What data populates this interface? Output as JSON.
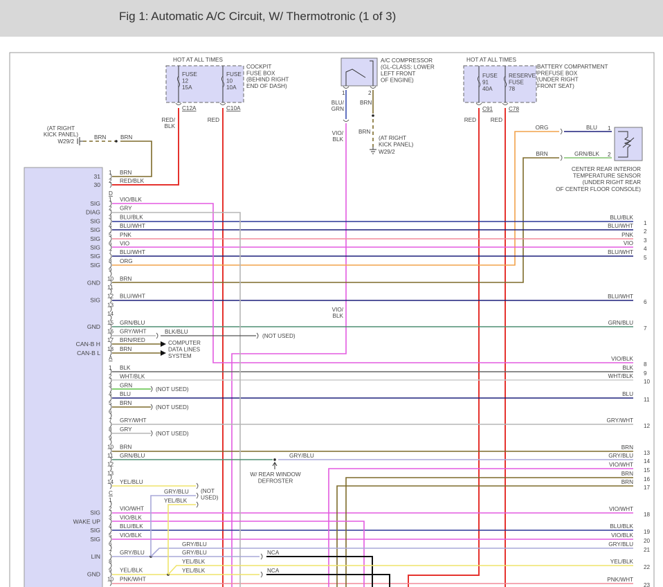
{
  "title": "Fig 1: Automatic A/C Circuit, W/ Thermotronic (1 of 3)",
  "wire_colors": {
    "BRN": "#7d6a2a",
    "RED": "#e5322d",
    "VIO": "#e35ae0",
    "BLU": "#1c1f7a",
    "BLU/BLK": "#2a3596",
    "GRY": "#b5b5b5",
    "PNK": "#f28a9a",
    "ORG": "#f2a24a",
    "GRN/BLU": "#4d8e72",
    "GRN": "#5cc043",
    "GRN/BLK": "#7fc06a",
    "BLK": "#666666",
    "WHT/BLK": "#cccccc",
    "GRY/BLU": "#a8a8d8",
    "YEL": "#efe46a",
    "NCA": "#111111",
    "BLU/GRN": "#3a4fb0",
    "box_fill": "#d9d9f7"
  },
  "main_connector": {
    "pins": [
      {
        "num": "1",
        "wire": "BRN",
        "func": "31"
      },
      {
        "num": "2",
        "wire": "RED/BLK",
        "func": "30"
      }
    ]
  },
  "connector_D": {
    "name": "D",
    "pins": [
      {
        "num": "1",
        "wire": "VIO/BLK",
        "func": "SIG"
      },
      {
        "num": "2",
        "wire": "GRY",
        "func": "DIAG"
      },
      {
        "num": "3",
        "wire": "BLU/BLK",
        "func": "SIG"
      },
      {
        "num": "4",
        "wire": "BLU/WHT",
        "func": "SIG"
      },
      {
        "num": "5",
        "wire": "PNK",
        "func": "SIG"
      },
      {
        "num": "6",
        "wire": "VIO",
        "func": "SIG"
      },
      {
        "num": "7",
        "wire": "BLU/WHT",
        "func": "SIG"
      },
      {
        "num": "8",
        "wire": "ORG",
        "func": "SIG"
      },
      {
        "num": "9",
        "wire": "",
        "func": ""
      },
      {
        "num": "10",
        "wire": "BRN",
        "func": "GND"
      },
      {
        "num": "11",
        "wire": "",
        "func": ""
      },
      {
        "num": "12",
        "wire": "BLU/WHT",
        "func": "SIG"
      },
      {
        "num": "13",
        "wire": "",
        "func": ""
      },
      {
        "num": "14",
        "wire": "",
        "func": ""
      },
      {
        "num": "15",
        "wire": "GRN/BLU",
        "func": "GND"
      },
      {
        "num": "16",
        "wire": "GRY/WHT",
        "func": ""
      },
      {
        "num": "17",
        "wire": "BRN/RED",
        "func": "CAN-B H"
      },
      {
        "num": "18",
        "wire": "BRN",
        "func": "CAN-B L"
      }
    ]
  },
  "connector_A": {
    "name": "A",
    "pins": [
      {
        "num": "1",
        "wire": "BLK"
      },
      {
        "num": "2",
        "wire": "WHT/BLK"
      },
      {
        "num": "3",
        "wire": "GRN"
      },
      {
        "num": "4",
        "wire": "BLU"
      },
      {
        "num": "5",
        "wire": "BRN"
      },
      {
        "num": "6",
        "wire": ""
      },
      {
        "num": "7",
        "wire": "GRY/WHT"
      },
      {
        "num": "8",
        "wire": "GRY"
      },
      {
        "num": "9",
        "wire": ""
      },
      {
        "num": "10",
        "wire": "BRN"
      },
      {
        "num": "11",
        "wire": "GRN/BLU"
      },
      {
        "num": "12",
        "wire": ""
      },
      {
        "num": "13",
        "wire": ""
      },
      {
        "num": "14",
        "wire": "YEL/BLU"
      }
    ]
  },
  "connector_C": {
    "name": "C",
    "pins": [
      {
        "num": "1",
        "wire": "",
        "func": ""
      },
      {
        "num": "2",
        "wire": "VIO/WHT",
        "func": "SIG"
      },
      {
        "num": "3",
        "wire": "VIO/BLK",
        "func": "WAKE UP"
      },
      {
        "num": "4",
        "wire": "BLU/BLK",
        "func": "SIG"
      },
      {
        "num": "5",
        "wire": "VIO/BLK",
        "func": "SIG"
      },
      {
        "num": "6",
        "wire": "",
        "func": ""
      },
      {
        "num": "7",
        "wire": "GRY/BLU",
        "func": "LIN"
      },
      {
        "num": "8",
        "wire": "",
        "func": ""
      },
      {
        "num": "9",
        "wire": "YEL/BLK",
        "func": "GND"
      },
      {
        "num": "10",
        "wire": "PNK/WHT",
        "func": ""
      }
    ]
  },
  "outputs": [
    {
      "num": "1",
      "wire": "BLU/BLK"
    },
    {
      "num": "2",
      "wire": "BLU/WHT"
    },
    {
      "num": "3",
      "wire": "PNK"
    },
    {
      "num": "4",
      "wire": "VIO"
    },
    {
      "num": "5",
      "wire": "BLU/WHT"
    },
    {
      "num": "6",
      "wire": "BLU/WHT"
    },
    {
      "num": "7",
      "wire": "GRN/BLU"
    },
    {
      "num": "8",
      "wire": "VIO/BLK"
    },
    {
      "num": "9",
      "wire": "BLK"
    },
    {
      "num": "10",
      "wire": "WHT/BLK"
    },
    {
      "num": "11",
      "wire": "BLU"
    },
    {
      "num": "12",
      "wire": "GRY/WHT"
    },
    {
      "num": "13",
      "wire": "BRN"
    },
    {
      "num": "14",
      "wire": "GRY/BLU"
    },
    {
      "num": "15",
      "wire": "VIO/WHT"
    },
    {
      "num": "16",
      "wire": "BRN"
    },
    {
      "num": "17",
      "wire": "BRN"
    },
    {
      "num": "18",
      "wire": "VIO/WHT"
    },
    {
      "num": "19",
      "wire": "BLU/BLK"
    },
    {
      "num": "20",
      "wire": "VIO/BLK"
    },
    {
      "num": "21",
      "wire": "GRY/BLU"
    },
    {
      "num": "22",
      "wire": "YEL/BLK"
    },
    {
      "num": "23",
      "wire": "PNK/WHT"
    }
  ],
  "labels": {
    "hot1": "HOT AT ALL TIMES",
    "cockpit": [
      "COCKPIT",
      "FUSE BOX",
      "(BEHIND RIGHT",
      "END OF DASH)"
    ],
    "fuse12": [
      "FUSE",
      "12",
      "15A"
    ],
    "fuse10": [
      "FUSE",
      "10",
      "10A"
    ],
    "c12a": "C12A",
    "c10a": "C10A",
    "red_blk": [
      "RED/",
      "BLK"
    ],
    "red1": "RED",
    "kick1": [
      "(AT RIGHT",
      "KICK PANEL)"
    ],
    "w29_1": "W29/2",
    "brn_a": "BRN",
    "brn_b": "BRN",
    "compressor": [
      "A/C COMPRESSOR",
      "(GL-CLASS: LOWER",
      "LEFT FRONT",
      "OF ENGINE)"
    ],
    "comp_pin1": "1",
    "comp_pin2": "2",
    "blu_grn": [
      "BLU/",
      "GRN"
    ],
    "comp_brn": "BRN",
    "vio_blk_top": [
      "VIO/",
      "BLK"
    ],
    "comp_brn2": "BRN",
    "kick2": [
      "(AT RIGHT",
      "KICK PANEL)"
    ],
    "w29_2": "W29/2",
    "hot2": "HOT AT ALL TIMES",
    "battery": [
      "BATTERY COMPARTMENT",
      "PREFUSE BOX",
      "(UNDER RIGHT",
      "FRONT SEAT)"
    ],
    "fuse91": [
      "FUSE",
      "91",
      "40A"
    ],
    "reserve": [
      "RESERVE",
      "FUSE",
      "78"
    ],
    "c91": "C91",
    "c78": "C78",
    "red2": "RED",
    "red3": "RED",
    "org": "ORG",
    "blu": "BLU",
    "brn_s": "BRN",
    "grn_blk": "GRN/BLK",
    "sensor_pin1": "1",
    "sensor_pin2": "2",
    "sensor": [
      "CENTER REAR INTERIOR",
      "TEMPERATURE SENSOR",
      "(UNDER RIGHT REAR",
      "OF CENTER FLOOR CONSOLE)"
    ],
    "vio_blk_mid": [
      "VIO/",
      "BLK"
    ],
    "blk_blu": "BLK/BLU",
    "not_used": "(NOT USED)",
    "cdl": [
      "COMPUTER",
      "DATA LINES",
      "SYSTEM"
    ],
    "not_used_a3": "(NOT USED)",
    "not_used_a5": "(NOT USED)",
    "not_used_a8": "(NOT USED)",
    "gry_blu_splice": "GRY/BLU",
    "defroster": [
      "W/ REAR WINDOW",
      "DEFROSTER"
    ],
    "not_used_c": [
      "(NOT",
      "USED)"
    ],
    "gry_blu_c": "GRY/BLU",
    "yel_blk_c": "YEL/BLK",
    "gry_blu_21": "GRY/BLU",
    "gry_blu_lin": "GRY/BLU",
    "yel_blk_22": "YEL/BLK",
    "yel_blk_gnd": "YEL/BLK",
    "nca1": "NCA",
    "nca2": "NCA"
  }
}
